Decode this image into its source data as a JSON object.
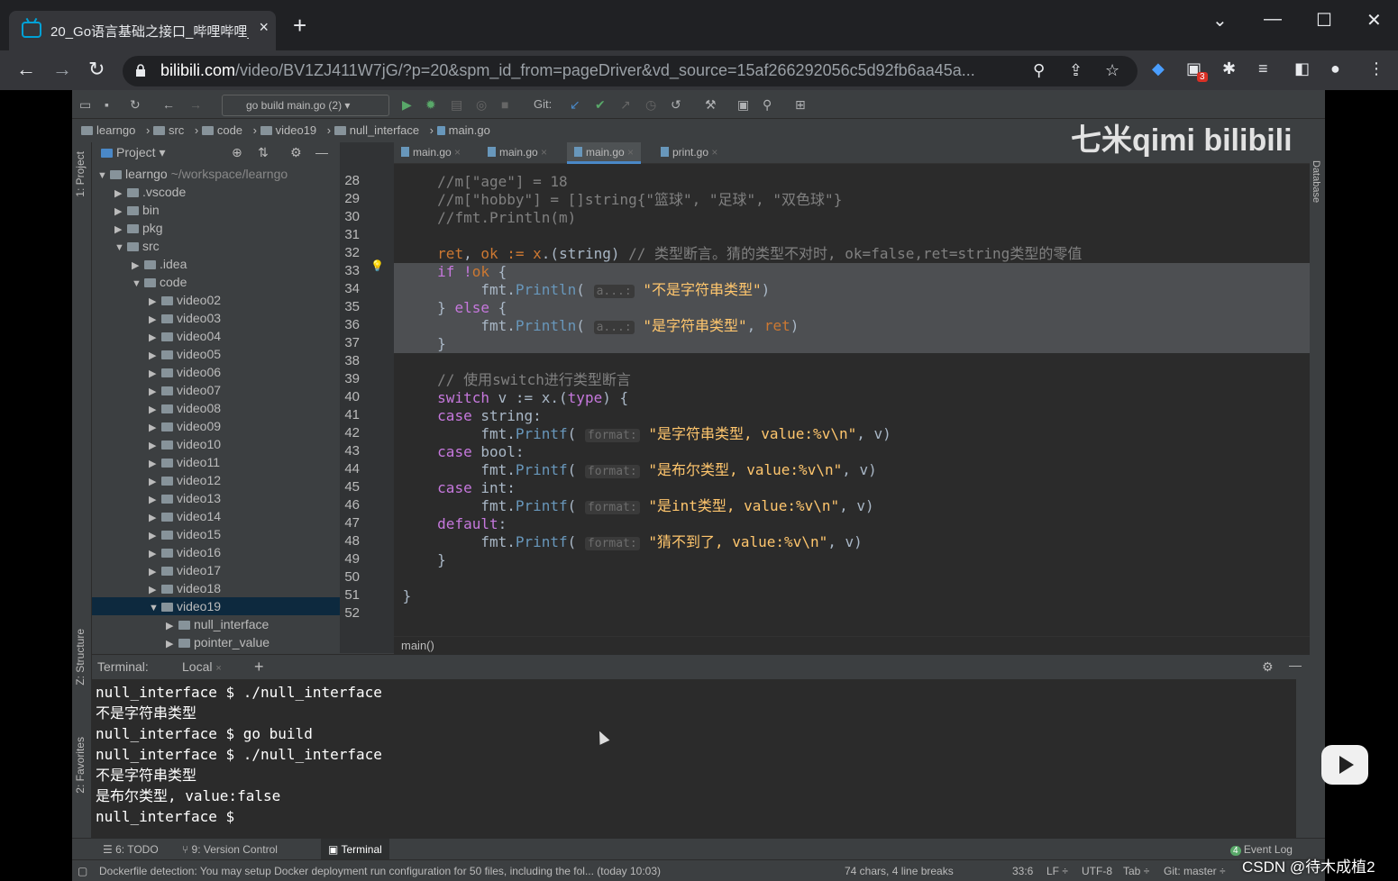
{
  "browser": {
    "tab_title": "20_Go语言基础之接口_哔哩哔哩_",
    "tab_close": "×",
    "new_tab": "+",
    "url_domain": "bilibili.com",
    "url_path": "/video/BV1ZJ411W7jG/?p=20&spm_id_from=pageDriver&vd_source=15af266292056c5d92fb6aa45a...",
    "extension_badge": "3"
  },
  "ide": {
    "run_config": "go build main.go (2)",
    "git_label": "Git:",
    "breadcrumb": [
      "learngo",
      "src",
      "code",
      "video19",
      "null_interface",
      "main.go"
    ],
    "project_header": "Project",
    "left_tabs": {
      "project": "1: Project",
      "structure": "Z: Structure",
      "favorites": "2: Favorites"
    },
    "right_tab": "Database",
    "tree": [
      {
        "label": "learngo",
        "extra": "~/workspace/learngo",
        "level": 0,
        "open": true
      },
      {
        "label": ".vscode",
        "level": 1,
        "open": false
      },
      {
        "label": "bin",
        "level": 1,
        "open": false
      },
      {
        "label": "pkg",
        "level": 1,
        "open": false
      },
      {
        "label": "src",
        "level": 1,
        "open": true
      },
      {
        "label": ".idea",
        "level": 2,
        "open": false
      },
      {
        "label": "code",
        "level": 2,
        "open": true
      },
      {
        "label": "video02",
        "level": 3,
        "open": false
      },
      {
        "label": "video03",
        "level": 3,
        "open": false
      },
      {
        "label": "video04",
        "level": 3,
        "open": false
      },
      {
        "label": "video05",
        "level": 3,
        "open": false
      },
      {
        "label": "video06",
        "level": 3,
        "open": false
      },
      {
        "label": "video07",
        "level": 3,
        "open": false
      },
      {
        "label": "video08",
        "level": 3,
        "open": false
      },
      {
        "label": "video09",
        "level": 3,
        "open": false
      },
      {
        "label": "video10",
        "level": 3,
        "open": false
      },
      {
        "label": "video11",
        "level": 3,
        "open": false
      },
      {
        "label": "video12",
        "level": 3,
        "open": false
      },
      {
        "label": "video13",
        "level": 3,
        "open": false
      },
      {
        "label": "video14",
        "level": 3,
        "open": false
      },
      {
        "label": "video15",
        "level": 3,
        "open": false
      },
      {
        "label": "video16",
        "level": 3,
        "open": false
      },
      {
        "label": "video17",
        "level": 3,
        "open": false
      },
      {
        "label": "video18",
        "level": 3,
        "open": false
      },
      {
        "label": "video19",
        "level": 3,
        "open": true,
        "selected": true
      },
      {
        "label": "null_interface",
        "level": 4,
        "open": false
      },
      {
        "label": "pointer_value",
        "level": 4,
        "open": false
      }
    ],
    "editor_tabs": [
      "main.go",
      "main.go",
      "main.go",
      "print.go"
    ],
    "active_editor_tab": 2,
    "line_numbers": [
      "28",
      "29",
      "30",
      "31",
      "32",
      "33",
      "34",
      "35",
      "36",
      "37",
      "38",
      "39",
      "40",
      "41",
      "42",
      "43",
      "44",
      "45",
      "46",
      "47",
      "48",
      "49",
      "50",
      "51",
      "52"
    ],
    "code": {
      "l28": "//m[\"age\"] = 18",
      "l29": "//m[\"hobby\"] = []string{\"篮球\", \"足球\", \"双色球\"}",
      "l30": "//fmt.Println(m)",
      "l32_a": "ret, ok := x.(string) ",
      "l32_c": "// 类型断言。猜的类型不对时, ok=false,ret=string类型的零值",
      "l33_kw": "if",
      "l33_rest": " !ok {",
      "hint_a": "a...:",
      "hint_format": "format:",
      "l34_str": "\"不是字符串类型\"",
      "l35_a": "} ",
      "l35_kw": "else",
      "l35_b": " {",
      "l36_str": "\"是字符串类型\"",
      "l36_ret": "ret",
      "l37": "}",
      "l39": "// 使用switch进行类型断言",
      "l40_kw": "switch",
      "l40_rest": " v := x.(",
      "l40_type": "type",
      "l40_end": ") {",
      "case": "case",
      "l41_t": " string:",
      "l42_str": "\"是字符串类型, value:%v\\n\"",
      "l43_t": " bool:",
      "l44_str": "\"是布尔类型, value:%v\\n\"",
      "l45_t": " int:",
      "l46_str": "\"是int类型, value:%v\\n\"",
      "default": "default",
      "l48_str": "\"猜不到了, value:%v\\n\"",
      "close": "}",
      "fmt": "fmt.",
      "println": "Println",
      "printf": "Printf",
      "v_end": ", v)"
    },
    "editor_footer": "main()",
    "watermark": "七米qimi  bilibili",
    "terminal": {
      "label": "Terminal:",
      "tab": "Local",
      "lines": [
        "null_interface $ ./null_interface",
        "不是字符串类型",
        "null_interface $ go build",
        "null_interface $ ./null_interface",
        "不是字符串类型",
        "是布尔类型, value:false",
        "null_interface $"
      ]
    },
    "bottom_tabs": [
      "6: TODO",
      "9: Version Control",
      "Terminal"
    ],
    "event_log": "Event Log",
    "event_count": "4",
    "status": {
      "message": "Dockerfile detection: You may setup Docker deployment run configuration for 50 files, including the fol... (today 10:03)",
      "chars": "74 chars, 4 line breaks",
      "position": "33:6",
      "line_sep": "LF",
      "encoding": "UTF-8",
      "indent": "Tab",
      "git": "Git: master"
    }
  },
  "overlay": {
    "csdn": "CSDN @待木成植2"
  }
}
